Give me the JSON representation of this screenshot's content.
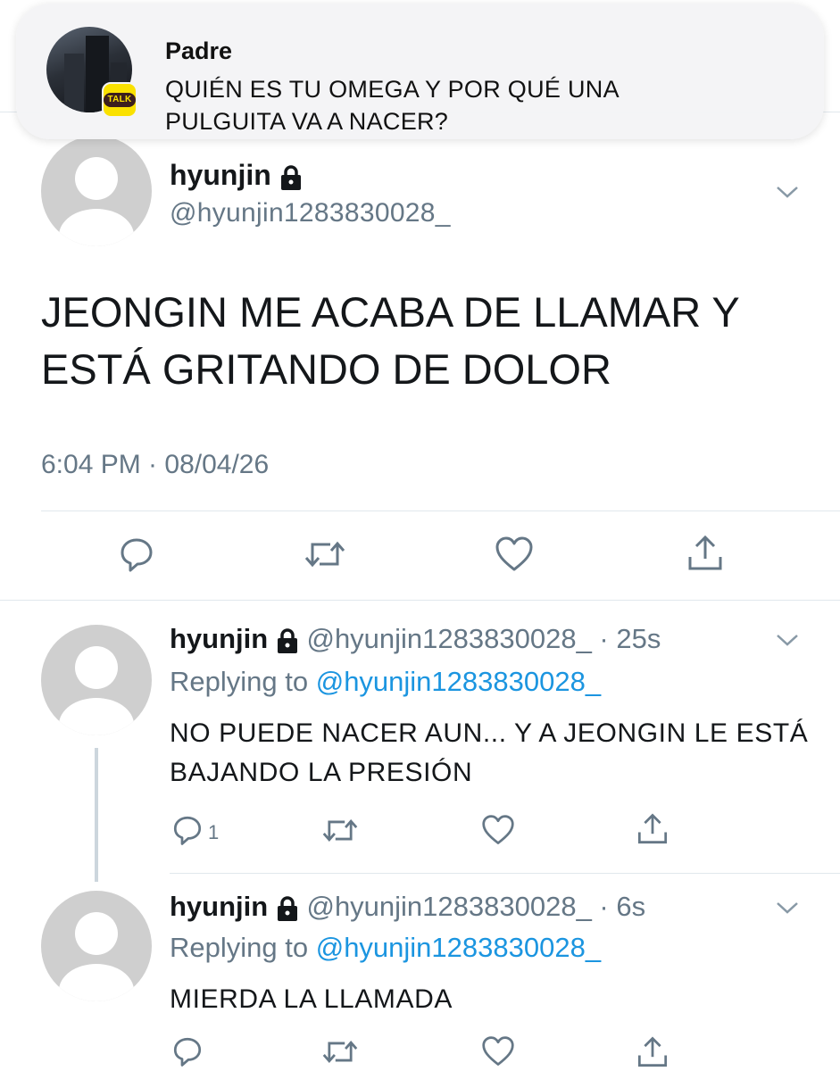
{
  "notification": {
    "sender": "Padre",
    "message": "QUIÉN ES TU OMEGA Y POR QUÉ UNA PULGUITA VA A NACER?",
    "app_badge": "TALK",
    "app_icon": "kakaotalk-icon"
  },
  "main_tweet": {
    "display_name": "hyunjin",
    "handle": "@hyunjin1283830028_",
    "text": "JEONGIN ME ACABA DE LLAMAR Y ESTÁ GRITANDO DE DOLOR",
    "timestamp": "6:04 PM · 08/04/26"
  },
  "replies": [
    {
      "display_name": "hyunjin",
      "handle_time": "@hyunjin1283830028_ · 25s",
      "replying_prefix": "Replying to",
      "replying_to": "@hyunjin1283830028_",
      "text": "NO PUEDE NACER AUN... Y A JEONGIN LE ESTÁ BAJANDO LA PRESIÓN",
      "reply_count": "1"
    },
    {
      "display_name": "hyunjin",
      "handle_time": "@hyunjin1283830028_ · 6s",
      "replying_prefix": "Replying to",
      "replying_to": "@hyunjin1283830028_",
      "text": "MIERDA LA LLAMADA",
      "reply_count": ""
    }
  ],
  "colors": {
    "link": "#1b95e0",
    "secondary_text": "#657786",
    "kakao_yellow": "#fae100"
  }
}
